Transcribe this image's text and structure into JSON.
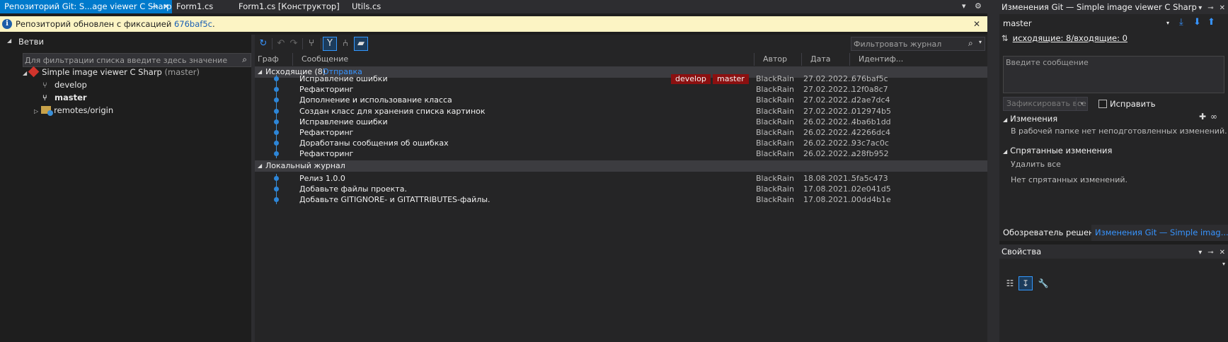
{
  "tabs": [
    {
      "label": "Репозиторий Git: S...age viewer C Sharp",
      "active": true
    },
    {
      "label": "Form1.cs",
      "active": false
    },
    {
      "label": "Form1.cs [Конструктор]",
      "active": false
    },
    {
      "label": "Utils.cs",
      "active": false
    }
  ],
  "infobar": {
    "text": "Репозиторий обновлен с фиксацией ",
    "commit_link": "676baf5c",
    "suffix": "."
  },
  "branches": {
    "title": "Ветви",
    "filter_placeholder": "Для фильтрации списка введите здесь значение",
    "repo_name": "Simple image viewer C Sharp",
    "repo_branch": "(master)",
    "items": [
      {
        "label": "develop",
        "bold": false
      },
      {
        "label": "master",
        "bold": true
      },
      {
        "label": "remotes/origin",
        "bold": false
      }
    ]
  },
  "history": {
    "filter_placeholder": "Фильтровать журнал",
    "columns": [
      "Граф",
      "Сообщение",
      "Автор",
      "Дата",
      "Идентиф..."
    ],
    "outgoing_title": "Исходящие (8)",
    "outgoing_link": "Отправка",
    "outgoing": [
      {
        "message": "Исправление ошибки",
        "author": "BlackRain",
        "date": "27.02.2022...",
        "id": "676baf5c",
        "tags": [
          "develop",
          "master"
        ]
      },
      {
        "message": "Рефакторинг",
        "author": "BlackRain",
        "date": "27.02.2022...",
        "id": "12f0a8c7",
        "tags": []
      },
      {
        "message": "Дополнение и использование класса",
        "author": "BlackRain",
        "date": "27.02.2022...",
        "id": "d2ae7dc4",
        "tags": []
      },
      {
        "message": "Создан класс для хранения списка картинок",
        "author": "BlackRain",
        "date": "27.02.2022...",
        "id": "012974b5",
        "tags": []
      },
      {
        "message": "Исправление ошибки",
        "author": "BlackRain",
        "date": "26.02.2022...",
        "id": "4ba6b1dd",
        "tags": []
      },
      {
        "message": "Рефакторинг",
        "author": "BlackRain",
        "date": "26.02.2022...",
        "id": "42266dc4",
        "tags": []
      },
      {
        "message": "Доработаны сообщения об ошибках",
        "author": "BlackRain",
        "date": "26.02.2022...",
        "id": "93c7ac0c",
        "tags": []
      },
      {
        "message": "Рефакторинг",
        "author": "BlackRain",
        "date": "26.02.2022...",
        "id": "a28fb952",
        "tags": []
      }
    ],
    "local_title": "Локальный журнал",
    "local": [
      {
        "message": "Релиз 1.0.0",
        "author": "BlackRain",
        "date": "18.08.2021...",
        "id": "5fa5c473",
        "tags": []
      },
      {
        "message": "Добавьте файлы проекта.",
        "author": "BlackRain",
        "date": "17.08.2021...",
        "id": "02e041d5",
        "tags": []
      },
      {
        "message": "Добавьте GITIGNORE- и GITATTRIBUTES-файлы.",
        "author": "BlackRain",
        "date": "17.08.2021...",
        "id": "00dd4b1e",
        "tags": []
      }
    ]
  },
  "git_changes": {
    "title": "Изменения Git — Simple image viewer C Sharp",
    "branch": "master",
    "sync": "исходящие: 8/входящие: 0",
    "message_placeholder": "Введите сообщение",
    "commit_button": "Зафиксировать все",
    "amend_label": "Исправить",
    "changes_title": "Изменения",
    "changes_empty": "В рабочей папке нет неподготовленных изменений.",
    "stash_title": "Спрятанные изменения",
    "stash_delete": "Удалить все",
    "stash_empty": "Нет спрятанных изменений."
  },
  "bottom_tabs": [
    {
      "label": "Обозреватель решений",
      "active": true
    },
    {
      "label": "Изменения Git — Simple imag...",
      "active": false
    }
  ],
  "properties": {
    "title": "Свойства"
  },
  "colors": {
    "accent": "#007acc",
    "tag_bg": "#8b1010",
    "graph": "#2d86d8",
    "repo_icon": "#d0342c",
    "infobar_bg": "#fcf4c4"
  }
}
